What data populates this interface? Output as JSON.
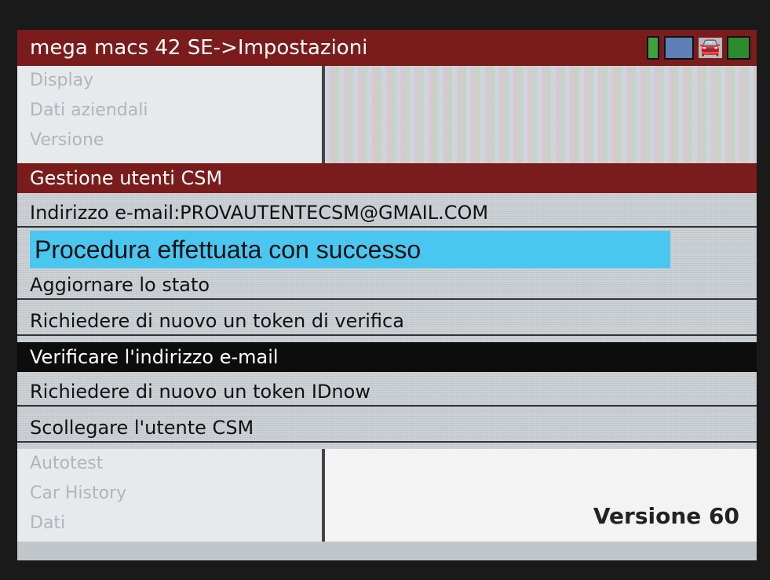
{
  "titlebar": {
    "title": "mega macs 42 SE->Impostazioni"
  },
  "status_icons": [
    "battery-icon",
    "monitor-icon",
    "car-icon",
    "network-icon"
  ],
  "top_menu": {
    "items": [
      "Display",
      "Dati aziendali",
      "Versione"
    ]
  },
  "section": {
    "header": "Gestione utenti CSM"
  },
  "email": {
    "label": "Indirizzo e-mail:PROVAUTENTECSM@GMAIL.COM"
  },
  "banner": {
    "text": "Procedura effettuata con successo",
    "color": "#49c7f0"
  },
  "actions": [
    "Aggiornare lo stato",
    "Richiedere di nuovo un token di verifica",
    "Verificare l'indirizzo e-mail",
    "Richiedere di nuovo un token IDnow",
    "Scollegare l'utente CSM"
  ],
  "selected_action": "Verificare l'indirizzo e-mail",
  "bottom_menu": {
    "items": [
      "Autotest",
      "Car History",
      "Dati"
    ]
  },
  "footer": {
    "version": "Versione 60"
  },
  "colors": {
    "accent": "#7b1c1c",
    "selection": "#0d0d0d"
  }
}
